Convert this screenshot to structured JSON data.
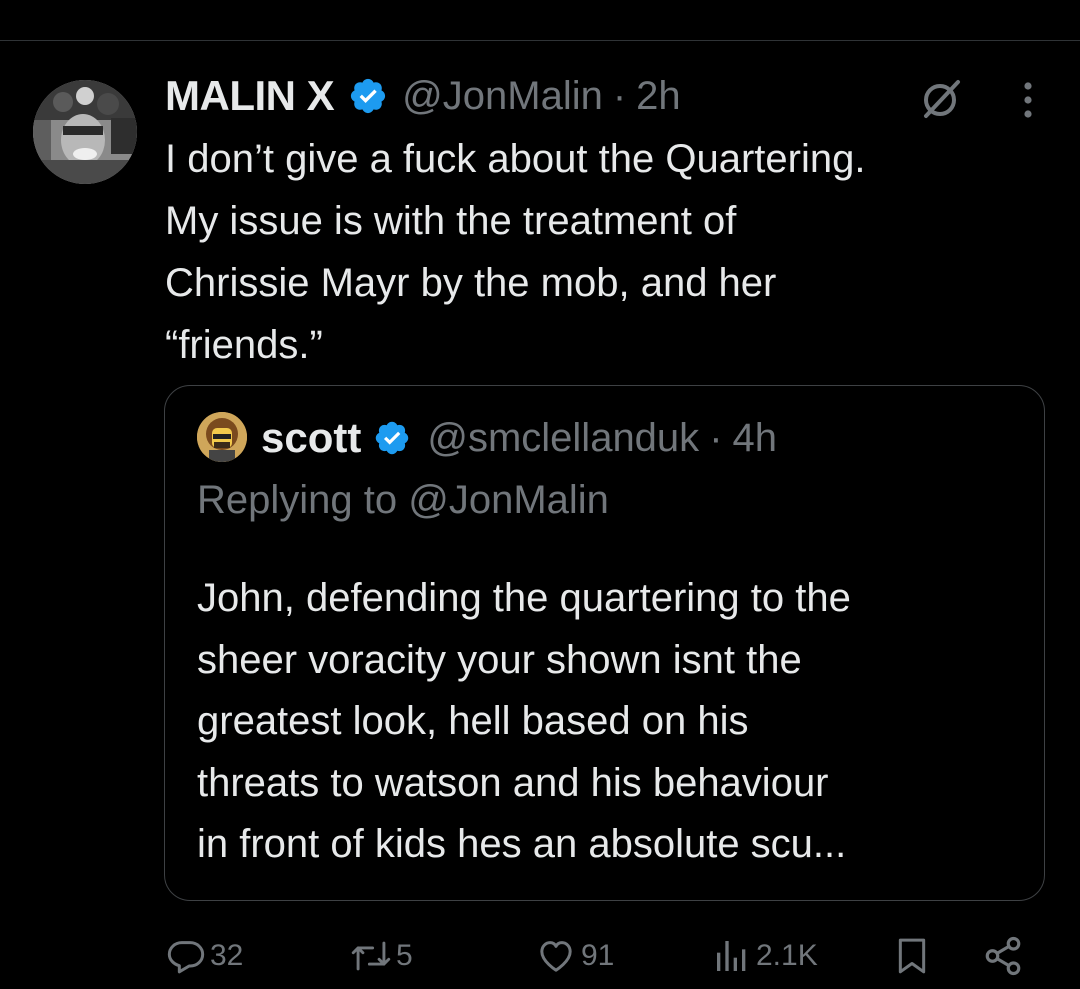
{
  "tweet": {
    "author": {
      "display_name": "MALIN X",
      "handle": "@JonMalin",
      "verified": true
    },
    "separator": "·",
    "timestamp": "2h",
    "text_lines": [
      "I don’t give a fuck about the Quartering.",
      "My issue is with the treatment of",
      "Chrissie Mayr by the mob, and her",
      "“friends.”"
    ]
  },
  "quoted_tweet": {
    "author": {
      "display_name": "scott",
      "handle": "@smclellanduk",
      "verified": true
    },
    "separator": "·",
    "timestamp": "4h",
    "replying_to": "Replying to @JonMalin",
    "text_lines": [
      "John, defending the quartering to the",
      "sheer voracity your shown isnt the",
      "greatest look, hell based on his",
      "threats to watson and his behaviour",
      "in front of kids hes an absolute scu..."
    ]
  },
  "actions": {
    "replies": "32",
    "reposts": "5",
    "likes": "91",
    "views": "2.1K"
  },
  "icons": {
    "verified": "verified-badge-icon",
    "grok": "grok-icon",
    "more": "more-options-icon",
    "reply": "reply-icon",
    "repost": "repost-icon",
    "like": "heart-icon",
    "views": "views-chart-icon",
    "bookmark": "bookmark-icon",
    "share": "share-icon"
  },
  "colors": {
    "background": "#000000",
    "primary_text": "#e7e9ea",
    "secondary_text": "#71767b",
    "verified_blue": "#1d9bf0",
    "border": "#3e4144"
  }
}
